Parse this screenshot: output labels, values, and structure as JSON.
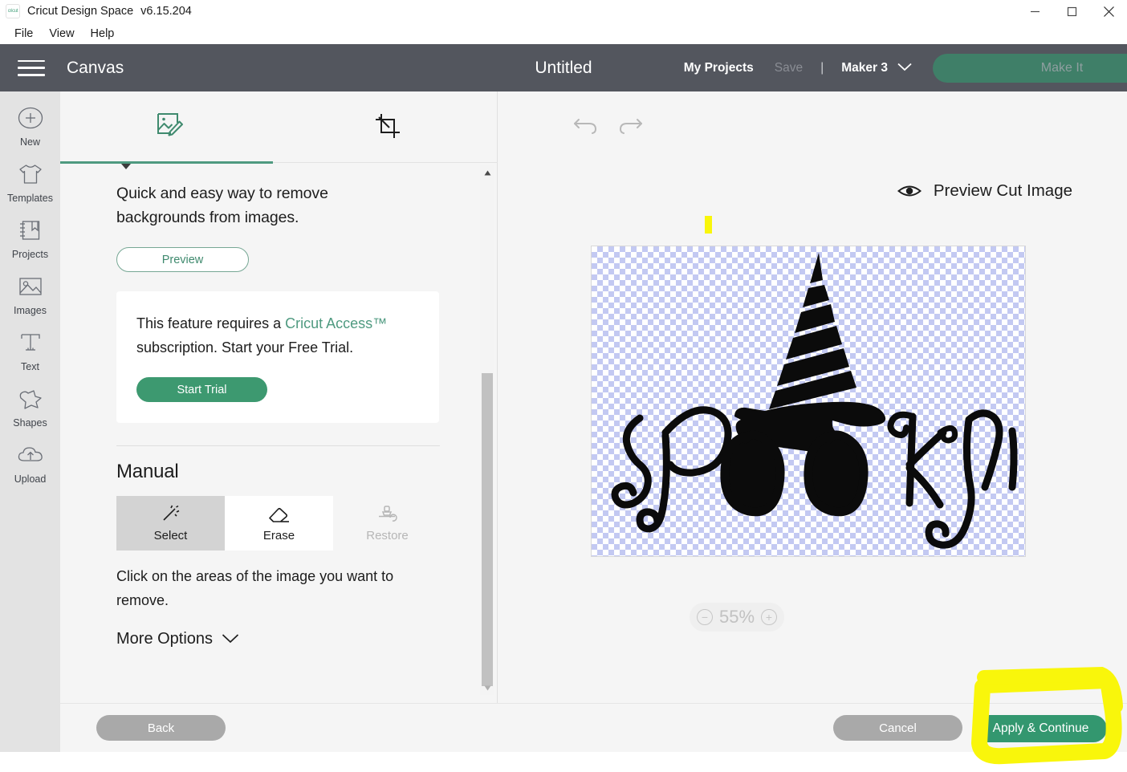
{
  "window": {
    "app_title": "Cricut Design Space",
    "version": "v6.15.204",
    "logo_text": "cricut",
    "controls": {
      "minimize": "minimize-icon",
      "maximize": "maximize-icon",
      "close": "close-icon"
    }
  },
  "menubar": {
    "items": [
      "File",
      "View",
      "Help"
    ]
  },
  "header": {
    "menu_icon": "hamburger-icon",
    "canvas_label": "Canvas",
    "document_title": "Untitled",
    "my_projects": "My Projects",
    "save": "Save",
    "separator": "|",
    "machine": "Maker 3",
    "machine_chevron": "chevron-down-icon",
    "make_it": "Make It",
    "bar_color": "#53565e",
    "make_it_color": "#3f7f68"
  },
  "sidebar": {
    "items": [
      {
        "label": "New",
        "icon": "plus-circle-icon"
      },
      {
        "label": "Templates",
        "icon": "tshirt-icon"
      },
      {
        "label": "Projects",
        "icon": "book-bookmark-icon"
      },
      {
        "label": "Images",
        "icon": "picture-icon"
      },
      {
        "label": "Text",
        "icon": "text-t-icon"
      },
      {
        "label": "Shapes",
        "icon": "shapes-icon"
      },
      {
        "label": "Upload",
        "icon": "cloud-upload-icon"
      }
    ]
  },
  "panel": {
    "tabs": [
      {
        "id": "remove-background",
        "icon": "image-edit-icon",
        "active": true
      },
      {
        "id": "crop",
        "icon": "crop-icon",
        "active": false
      }
    ],
    "description": "Quick and easy way to remove backgrounds from images.",
    "preview_button": "Preview",
    "access_card": {
      "text_part1": "This feature requires a ",
      "link_text": "Cricut Access™",
      "text_part2": " subscription. Start your Free Trial.",
      "cta": "Start Trial",
      "link_color": "#4f9a80",
      "cta_color": "#3d9970"
    },
    "manual_heading": "Manual",
    "tools": [
      {
        "label": "Select",
        "icon": "magic-wand-icon",
        "state": "active"
      },
      {
        "label": "Erase",
        "icon": "eraser-icon",
        "state": "normal"
      },
      {
        "label": "Restore",
        "icon": "restore-brush-icon",
        "state": "disabled"
      }
    ],
    "hint": "Click on the areas of the image you want to remove.",
    "more_options": "More Options",
    "more_options_chevron": "chevron-down-icon",
    "scrollbar": {
      "up": "scroll-up-arrow-icon",
      "down": "scroll-down-arrow-icon"
    }
  },
  "stage": {
    "undo": "undo-icon",
    "redo": "redo-icon",
    "preview_cut_image": "Preview Cut Image",
    "eye_icon": "eye-icon",
    "zoom": {
      "value": "55%",
      "minus": "minus-icon",
      "plus": "plus-icon"
    },
    "artwork": {
      "name": "spooky-witch-hat-artwork",
      "word": "spooky",
      "transparency_checker_color": "#c3c9f2"
    },
    "highlighter_mark_color": "#f9f60b"
  },
  "footer": {
    "back": "Back",
    "cancel": "Cancel",
    "apply_continue": "Apply & Continue",
    "apply_color": "#33976f",
    "disabled_color": "#a9a9a9"
  },
  "annotation": {
    "name": "yellow-highlight-circle",
    "color": "#f9f60b",
    "targets": "apply-continue-button"
  }
}
